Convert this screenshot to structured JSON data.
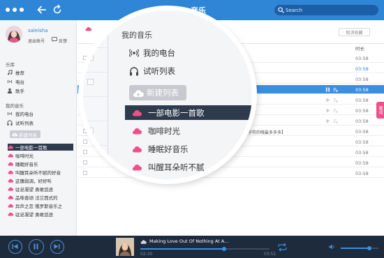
{
  "app": {
    "title": "…音乐"
  },
  "search": {
    "placeholder": "Search"
  },
  "user": {
    "name": "saleisha",
    "logout": "退出帐号",
    "feedback": "反馈"
  },
  "sidebar": {
    "library_header": "乐库",
    "library": [
      {
        "label": "推荐",
        "icon": "music-note-icon"
      },
      {
        "label": "电台",
        "icon": "radio-icon"
      },
      {
        "label": "歌手",
        "icon": "singer-icon"
      }
    ],
    "my_music_header": "我的音乐",
    "my_music": [
      {
        "label": "我的电台",
        "icon": "radio-icon"
      },
      {
        "label": "试听列表",
        "icon": "headphones-icon"
      }
    ],
    "new_list": "新建列表",
    "playlists": [
      "一部电影一首歌",
      "咖啡时光",
      "睡眠好音乐",
      "叫醒耳朵听不腻的好音",
      "这慵弱调，好好听",
      "驻足凝望 勇敢追逐",
      "品味香颂 法兰西式的",
      "异声之恋 俄罗斯音乐之",
      "驻足凝望 勇敢追逐"
    ],
    "active_playlist_index": 0
  },
  "list": {
    "cancel_collect": "取消收藏",
    "duration_header": "时长",
    "rows": [
      {
        "duration": "03:58",
        "highlight": false
      },
      {
        "duration": "03:58",
        "highlight": true
      },
      {
        "duration": "03:58",
        "highlight": false
      },
      {
        "duration": "03:58",
        "highlight": false,
        "selected": true
      },
      {
        "duration": "03:58",
        "highlight": false
      },
      {
        "duration": "03:58",
        "highlight": false
      },
      {
        "duration": "03:58",
        "highlight": false
      },
      {
        "duration": "03:58",
        "highlight": false,
        "text": "多字符的哦最多多多】"
      },
      {
        "duration": "03:58",
        "highlight": false
      },
      {
        "duration": "03:58",
        "highlight": false
      },
      {
        "duration": "03:58",
        "highlight": false
      },
      {
        "duration": "03:58",
        "highlight": false
      }
    ]
  },
  "hot_tab": "歌词",
  "magnifier": {
    "section_header": "我的音乐",
    "items": [
      {
        "label": "我的电台",
        "icon": "radio-icon"
      },
      {
        "label": "试听列表",
        "icon": "headphones-icon"
      }
    ],
    "new_list": "新建列表",
    "playlists": [
      "一部电影一首歌",
      "咖啡时光",
      "睡眠好音乐",
      "叫醒耳朵听不腻"
    ],
    "active_playlist_index": 0
  },
  "player": {
    "song_title": "Making Love Out Of Nothing At A...",
    "time_current": "02:30",
    "time_total": "03:51",
    "progress": 0.65,
    "volume": 0.75
  },
  "colors": {
    "titlebar": "#2f86d7",
    "player": "#1d2b3d",
    "accent_pink": "#f0508a",
    "selection_dark": "#2d3b4d",
    "selection_blue": "#3b8fe0"
  }
}
